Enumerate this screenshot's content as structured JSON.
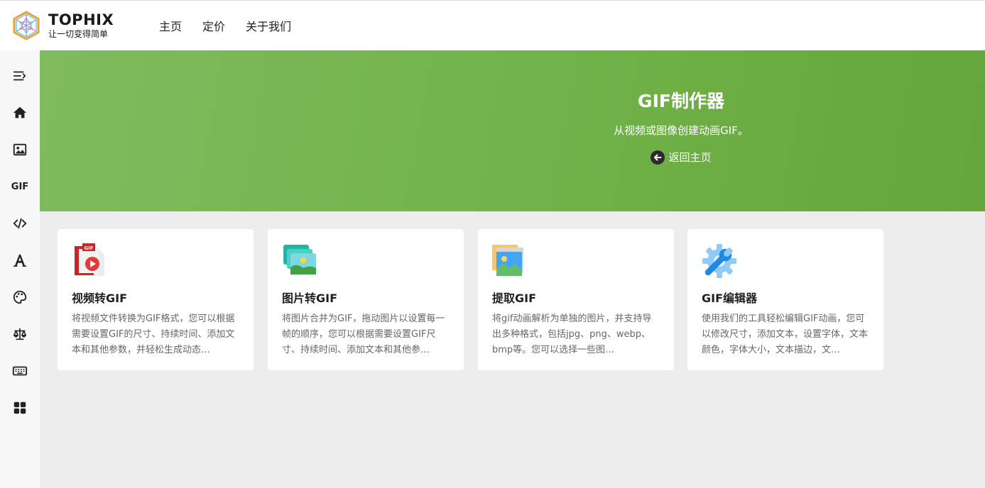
{
  "brand": {
    "name": "TOPHIX",
    "tagline": "让一切变得简单"
  },
  "nav": [
    {
      "label": "主页"
    },
    {
      "label": "定价"
    },
    {
      "label": "关于我们"
    }
  ],
  "sidebar": {
    "items": [
      {
        "icon": "menu-collapse-icon"
      },
      {
        "icon": "home-icon"
      },
      {
        "icon": "image-icon"
      },
      {
        "icon": "gif-icon",
        "label": "GIF"
      },
      {
        "icon": "code-icon"
      },
      {
        "icon": "font-icon"
      },
      {
        "icon": "palette-icon"
      },
      {
        "icon": "scale-icon"
      },
      {
        "icon": "keyboard-icon"
      },
      {
        "icon": "apps-icon"
      }
    ]
  },
  "hero": {
    "title": "GIF制作器",
    "subtitle": "从视频或图像创建动画GIF。",
    "back_label": "返回主页"
  },
  "cards": [
    {
      "title": "视频转GIF",
      "desc": "将视频文件转换为GIF格式，您可以根据需要设置GIF的尺寸、持续时间、添加文本和其他参数，并轻松生成动态…",
      "icon": "video-to-gif-icon"
    },
    {
      "title": "图片转GIF",
      "desc": "将图片合并为GIF，拖动图片以设置每一帧的顺序，您可以根据需要设置GIF尺寸、持续时间、添加文本和其他参…",
      "icon": "images-to-gif-icon"
    },
    {
      "title": "提取GIF",
      "desc": "将gif动画解析为单独的图片，并支持导出多种格式，包括jpg、png、webp、bmp等。您可以选择一些图…",
      "icon": "extract-gif-icon"
    },
    {
      "title": "GIF编辑器",
      "desc": "使用我们的工具轻松编辑GIF动画，您可以修改尺寸，添加文本，设置字体，文本颜色，字体大小，文本描边，文…",
      "icon": "gif-editor-icon"
    }
  ],
  "colors": {
    "hero_green": "#72b34b",
    "background": "#ededed"
  }
}
